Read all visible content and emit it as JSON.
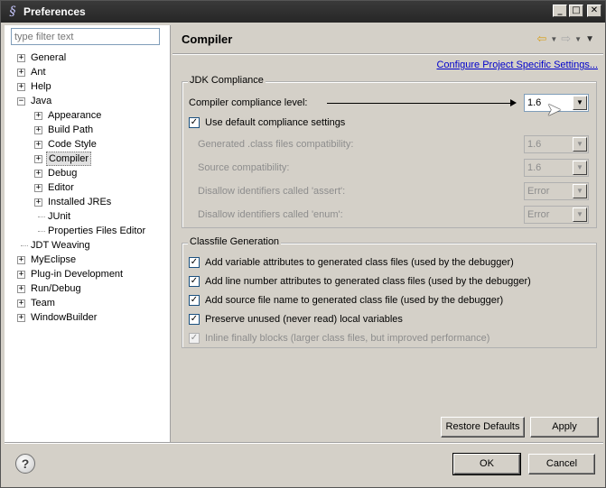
{
  "window": {
    "title": "Preferences",
    "minimize": "_",
    "maximize": "□",
    "close": "✕"
  },
  "sidebar": {
    "filter_placeholder": "type filter text",
    "items": [
      {
        "label": "General",
        "level": 0,
        "expander": "+"
      },
      {
        "label": "Ant",
        "level": 0,
        "expander": "+"
      },
      {
        "label": "Help",
        "level": 0,
        "expander": "+"
      },
      {
        "label": "Java",
        "level": 0,
        "expander": "−"
      },
      {
        "label": "Appearance",
        "level": 1,
        "expander": "+"
      },
      {
        "label": "Build Path",
        "level": 1,
        "expander": "+"
      },
      {
        "label": "Code Style",
        "level": 1,
        "expander": "+"
      },
      {
        "label": "Compiler",
        "level": 1,
        "expander": "+",
        "selected": true
      },
      {
        "label": "Debug",
        "level": 1,
        "expander": "+"
      },
      {
        "label": "Editor",
        "level": 1,
        "expander": "+"
      },
      {
        "label": "Installed JREs",
        "level": 1,
        "expander": "+"
      },
      {
        "label": "JUnit",
        "level": 1,
        "expander": ""
      },
      {
        "label": "Properties Files Editor",
        "level": 1,
        "expander": ""
      },
      {
        "label": "JDT Weaving",
        "level": 0,
        "expander": ""
      },
      {
        "label": "MyEclipse",
        "level": 0,
        "expander": "+"
      },
      {
        "label": "Plug-in Development",
        "level": 0,
        "expander": "+"
      },
      {
        "label": "Run/Debug",
        "level": 0,
        "expander": "+"
      },
      {
        "label": "Team",
        "level": 0,
        "expander": "+"
      },
      {
        "label": "WindowBuilder",
        "level": 0,
        "expander": "+"
      }
    ]
  },
  "main": {
    "title": "Compiler",
    "nav": {
      "back": "⇦",
      "forward": "⇨",
      "dropdown": "▼"
    },
    "configure_link": "Configure Project Specific Settings...",
    "jdk": {
      "title": "JDK Compliance",
      "compliance_label": "Compiler compliance level:",
      "compliance_value": "1.6",
      "use_default_label": "Use default compliance settings",
      "use_default_checked": "✓",
      "generated_label": "Generated .class files compatibility:",
      "generated_value": "1.6",
      "source_label": "Source compatibility:",
      "source_value": "1.6",
      "assert_label": "Disallow identifiers called 'assert':",
      "assert_value": "Error",
      "enum_label": "Disallow identifiers called 'enum':",
      "enum_value": "Error"
    },
    "classfile": {
      "title": "Classfile Generation",
      "items": [
        {
          "label": "Add variable attributes to generated class files (used by the debugger)",
          "mark": "✓",
          "enabled": true
        },
        {
          "label": "Add line number attributes to generated class files (used by the debugger)",
          "mark": "✓",
          "enabled": true
        },
        {
          "label": "Add source file name to generated class file (used by the debugger)",
          "mark": "✓",
          "enabled": true
        },
        {
          "label": "Preserve unused (never read) local variables",
          "mark": "✓",
          "enabled": true
        },
        {
          "label": "Inline finally blocks (larger class files, but improved performance)",
          "mark": "✓",
          "enabled": false
        }
      ]
    },
    "restore_defaults": "Restore Defaults",
    "apply": "Apply"
  },
  "footer": {
    "help": "?",
    "ok": "OK",
    "cancel": "Cancel"
  },
  "combo_arrow": "▼"
}
